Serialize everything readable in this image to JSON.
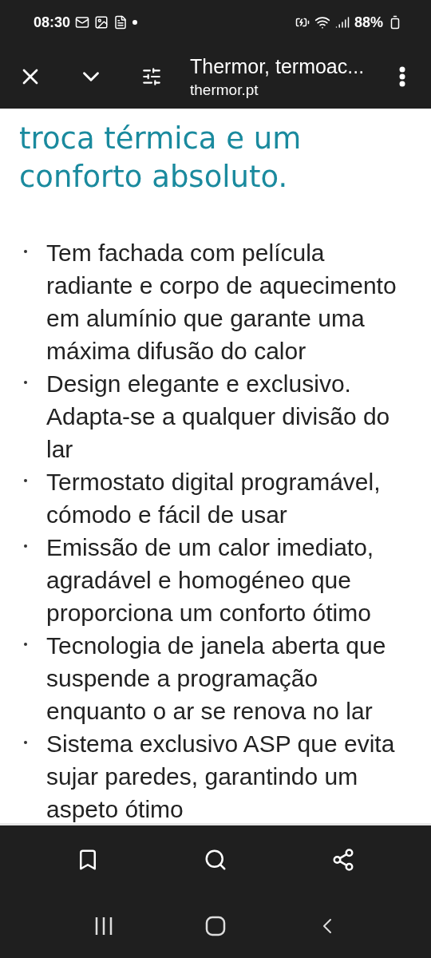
{
  "status_bar": {
    "time": "08:30",
    "battery": "88%"
  },
  "toolbar": {
    "title": "Thermor, termoac...",
    "url": "thermor.pt"
  },
  "heading": "troca térmica e um conforto absoluto.",
  "features": [
    "Tem fachada com película radiante e corpo de aquecimento em alumínio que garante uma máxima difusão do calor",
    "Design elegante e exclusivo. Adapta-se a qualquer divisão do lar",
    "Termostato digital programável, cómodo e fácil de usar",
    "Emissão de um calor imediato, agradável e homogéneo que proporciona um conforto ótimo",
    "Tecnologia de janela aberta que suspende a programação enquanto o ar se renova no lar",
    "Sistema exclusivo ASP que evita sujar paredes, garantindo um aspeto ótimo"
  ]
}
